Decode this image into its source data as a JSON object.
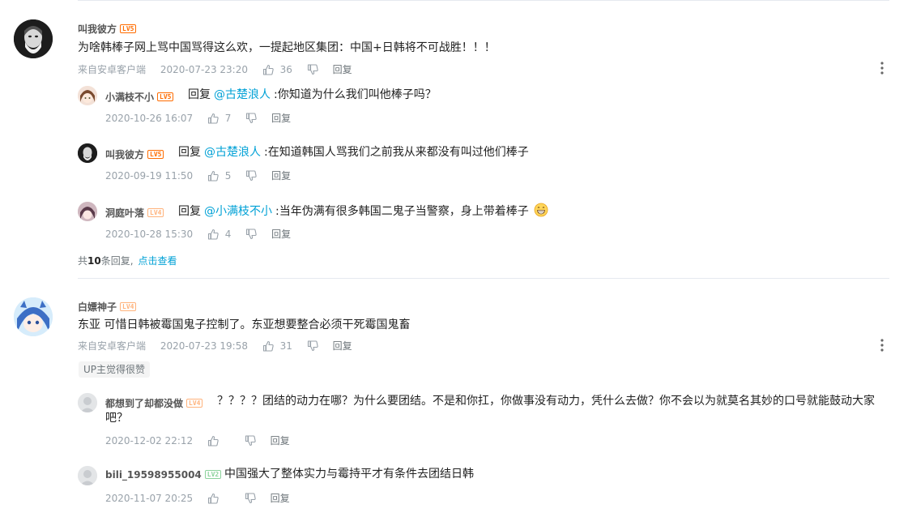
{
  "comments": [
    {
      "user": "叫我彼方",
      "level": "LV5",
      "text": "为啥韩棒子网上骂中国骂得这么欢，一提起地区集团：中国+日韩将不可战胜！！！",
      "source": "来自安卓客户端",
      "date": "2020-07-23 23:20",
      "likes": "36",
      "reply_label": "回复",
      "replies": [
        {
          "user": "小满枝不小",
          "level": "LV5",
          "reply_word": "回复",
          "mention": "@古楚浪人",
          "text": ":你知道为什么我们叫他棒子吗？",
          "date": "2020-10-26 16:07",
          "likes": "7",
          "reply_label": "回复"
        },
        {
          "user": "叫我彼方",
          "level": "LV5",
          "reply_word": "回复",
          "mention": "@古楚浪人",
          "text": ":在知道韩国人骂我们之前我从来都没有叫过他们棒子",
          "date": "2020-09-19 11:50",
          "likes": "5",
          "reply_label": "回复"
        },
        {
          "user": "洞庭叶落",
          "level": "LV4",
          "reply_word": "回复",
          "mention": "@小满枝不小",
          "text": ":当年伪满有很多韩国二鬼子当警察，身上带着棒子",
          "date": "2020-10-28 15:30",
          "likes": "4",
          "reply_label": "回复"
        }
      ],
      "more_prefix": "共",
      "more_count": "10",
      "more_suffix": "条回复,",
      "more_link": "点击查看"
    },
    {
      "user": "白嫖神子",
      "level": "LV4",
      "text": "东亚 可惜日韩被霉国鬼子控制了。东亚想要整合必须干死霉国鬼畜",
      "source": "来自安卓客户端",
      "date": "2020-07-23 19:58",
      "likes": "31",
      "reply_label": "回复",
      "up_badge": "UP主觉得很赞",
      "replies": [
        {
          "user": "都想到了却都没做",
          "level": "LV4",
          "text": "？？？？团结的动力在哪？为什么要团结。不是和你扛，你做事没有动力，凭什么去做？你不会以为就莫名其妙的口号就能鼓动大家吧？",
          "date": "2020-12-02 22:12",
          "reply_label": "回复"
        },
        {
          "user": "bili_19598955004",
          "level": "LV2",
          "text": "中国强大了整体实力与霉持平才有条件去团结日韩",
          "date": "2020-11-07 20:25",
          "reply_label": "回复"
        }
      ]
    }
  ],
  "colors": {
    "mention": "#00a1d6",
    "meta": "#99a2aa",
    "lv5": "#ff6c00",
    "lv4": "#ffb37c",
    "lv2": "#8bd29b"
  }
}
